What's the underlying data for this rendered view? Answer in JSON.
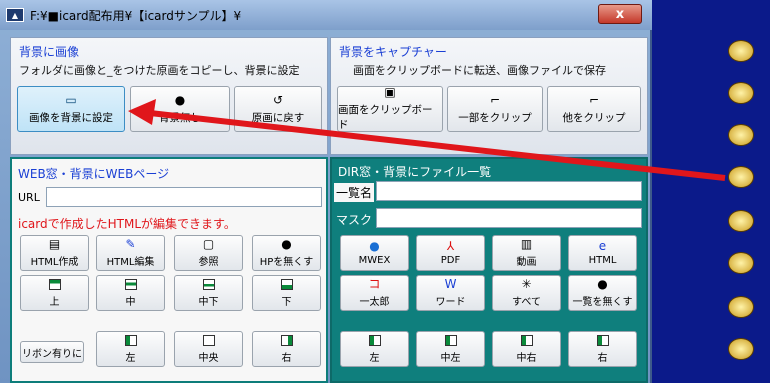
{
  "window": {
    "title": "F:¥■icard配布用¥【icardサンプル】¥",
    "close_label": "x"
  },
  "bg_image": {
    "title": "背景に画像",
    "subtitle": "フォルダに画像と_をつけた原画をコピーし、背景に設定",
    "buttons": [
      {
        "label": "画像を背景に設定",
        "icon": "image-icon"
      },
      {
        "label": "背景無し",
        "icon": "globe-icon"
      },
      {
        "label": "原画に戻す",
        "icon": "undo-icon"
      }
    ]
  },
  "capture": {
    "title": "背景をキャプチャー",
    "subtitle": "画面をクリップボードに転送、画像ファイルで保存",
    "buttons": [
      {
        "label": "画面をクリップボード",
        "icon": "clipboard-icon"
      },
      {
        "label": "一部をクリップ",
        "icon": "select-icon"
      },
      {
        "label": "他をクリップ",
        "icon": "select-other-icon"
      }
    ]
  },
  "web": {
    "title": "WEB窓・背景にWEBページ",
    "url_label": "URL",
    "note": "icardで作成したHTMLが編集できます。",
    "row1": [
      "HTML作成",
      "HTML編集",
      "参照",
      "HPを無くす"
    ],
    "row2": [
      "上",
      "中",
      "中下",
      "下"
    ],
    "row3": [
      "左",
      "中央",
      "右"
    ],
    "ribbon_label": "リボン有りに"
  },
  "dir": {
    "title": "DIR窓・背景にファイル一覧",
    "list_label": "一覧名",
    "mask_label": "マスク",
    "row1": [
      "MWEX",
      "PDF",
      "動画",
      "HTML"
    ],
    "row2": [
      "一太郎",
      "ワード",
      "すべて",
      "一覧を無くす"
    ],
    "row3": [
      "左",
      "中左",
      "中右",
      "右"
    ]
  },
  "colors": {
    "accent_blue": "#1a3fd4",
    "red_note": "#e0161b",
    "teal": "#0f7f7d",
    "desktop": "#0b1a8a"
  }
}
